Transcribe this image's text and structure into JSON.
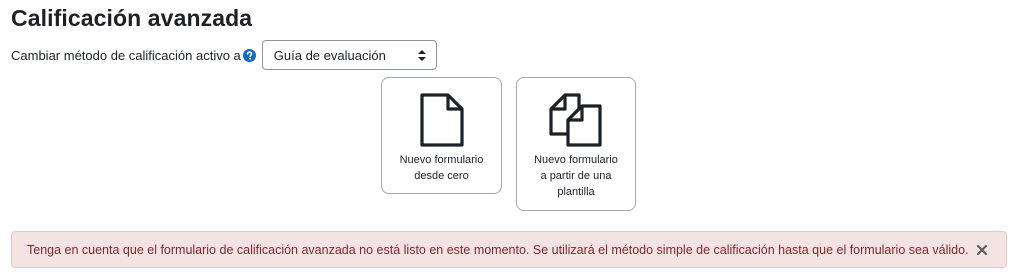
{
  "page": {
    "title": "Calificación avanzada"
  },
  "method": {
    "label": "Cambiar método de calificación activo a",
    "help_icon": "question-circle-icon",
    "selected_value": "Guía de evaluación"
  },
  "cards": [
    {
      "icon": "blank-document-icon",
      "label_lines": [
        "Nuevo formulario",
        "desde cero"
      ]
    },
    {
      "icon": "copy-documents-icon",
      "label_lines": [
        "Nuevo formulario",
        "a partir de una",
        "plantilla"
      ]
    }
  ],
  "alert": {
    "message": "Tenga en cuenta que el formulario de calificación avanzada no está listo en este momento. Se utilizará el método simple de calificación hasta que el formulario sea válido.",
    "close_icon": "close-icon"
  },
  "colors": {
    "alert_background": "#f4e3e3",
    "alert_text": "#7d2a2a",
    "help_icon": "#0f6cbf"
  }
}
